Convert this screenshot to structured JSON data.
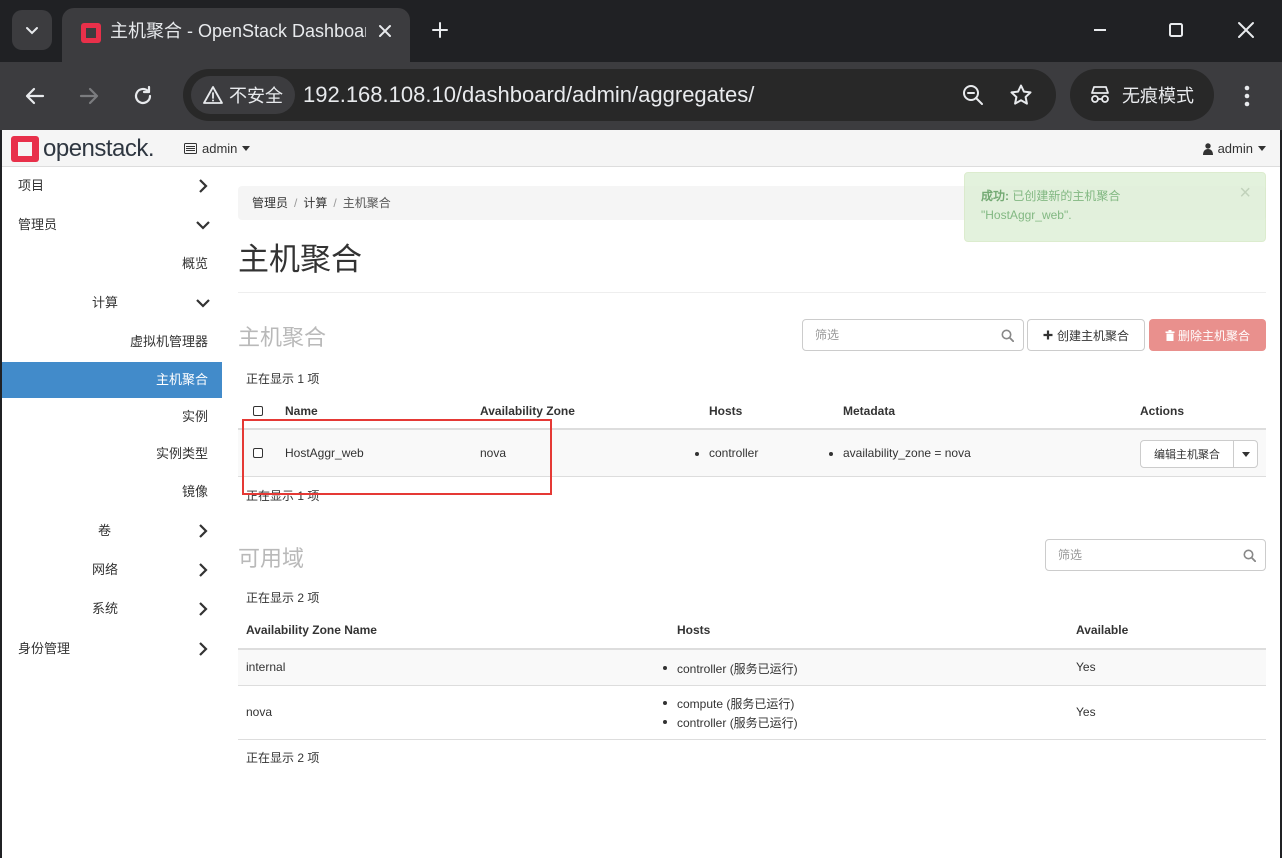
{
  "browser": {
    "tab_title": "主机聚合 - OpenStack Dashboard",
    "security_label": "不安全",
    "url": "192.168.108.10/dashboard/admin/aggregates/",
    "incognito_label": "无痕模式"
  },
  "header": {
    "logo_text": "openstack.",
    "project": "admin",
    "user": "admin"
  },
  "sidebar": {
    "items": [
      {
        "label": "项目"
      },
      {
        "label": "管理员"
      },
      {
        "label": "概览"
      },
      {
        "label": "计算"
      },
      {
        "label": "虚拟机管理器"
      },
      {
        "label": "主机聚合"
      },
      {
        "label": "实例"
      },
      {
        "label": "实例类型"
      },
      {
        "label": "镜像"
      },
      {
        "label": "卷"
      },
      {
        "label": "网络"
      },
      {
        "label": "系统"
      },
      {
        "label": "身份管理"
      }
    ]
  },
  "breadcrumb": [
    "管理员",
    "计算",
    "主机聚合"
  ],
  "page_title": "主机聚合",
  "alert": {
    "title": "成功:",
    "message": "已创建新的主机聚合",
    "detail": "\"HostAggr_web\"."
  },
  "aggregates": {
    "section_title": "主机聚合",
    "filter_placeholder": "筛选",
    "create_label": "创建主机聚合",
    "delete_label": "删除主机聚合",
    "count_text": "正在显示 1 项",
    "columns": [
      "Name",
      "Availability Zone",
      "Hosts",
      "Metadata",
      "Actions"
    ],
    "rows": [
      {
        "name": "HostAggr_web",
        "zone": "nova",
        "hosts": [
          "controller"
        ],
        "metadata": [
          "availability_zone = nova"
        ],
        "action_label": "编辑主机聚合"
      }
    ]
  },
  "zones": {
    "section_title": "可用域",
    "filter_placeholder": "筛选",
    "count_text": "正在显示 2 项",
    "columns": [
      "Availability Zone Name",
      "Hosts",
      "Available"
    ],
    "rows": [
      {
        "name": "internal",
        "hosts": [
          "controller (服务已运行)"
        ],
        "available": "Yes"
      },
      {
        "name": "nova",
        "hosts": [
          "compute (服务已运行)",
          "controller (服务已运行)"
        ],
        "available": "Yes"
      }
    ]
  },
  "colors": {
    "accent": "#428bca",
    "danger": "#e9908d",
    "success_bg": "#dff0d8",
    "highlight": "#e53935"
  }
}
